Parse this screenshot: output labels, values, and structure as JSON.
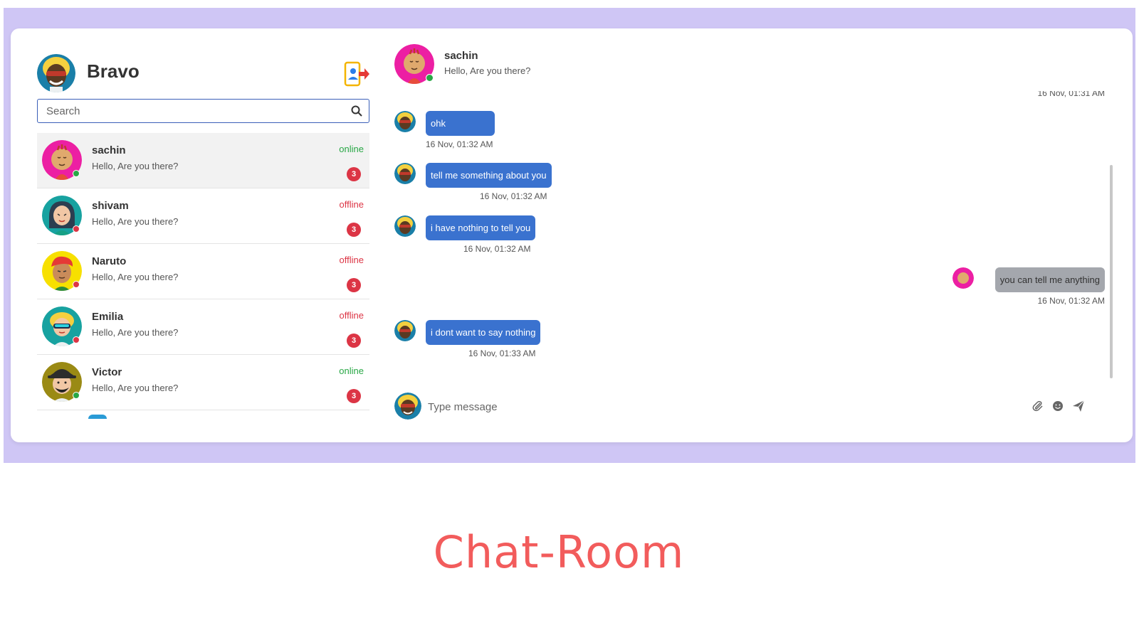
{
  "colors": {
    "background_frame": "#cfc6f5",
    "outgoing_bubble": "#3a72cf",
    "incoming_bubble": "#a4a7ad",
    "online": "#28a745",
    "offline": "#dc3545",
    "caption": "#f25c5c"
  },
  "user": {
    "name": "Bravo"
  },
  "search": {
    "placeholder": "Search"
  },
  "contacts": [
    {
      "name": "sachin",
      "preview": "Hello, Are you there?",
      "status": "online",
      "unread": "3"
    },
    {
      "name": "shivam",
      "preview": "Hello, Are you there?",
      "status": "offline",
      "unread": "3"
    },
    {
      "name": "Naruto",
      "preview": "Hello, Are you there?",
      "status": "offline",
      "unread": "3"
    },
    {
      "name": "Emilia",
      "preview": "Hello, Are you there?",
      "status": "offline",
      "unread": "3"
    },
    {
      "name": "Victor",
      "preview": "Hello, Are you there?",
      "status": "online",
      "unread": "3"
    }
  ],
  "chat": {
    "name": "sachin",
    "subtitle": "Hello, Are you there?",
    "partial_time": "16 Nov, 01:31 AM",
    "messages": [
      {
        "direction": "out",
        "text": "ohk",
        "time": "16 Nov, 01:32 AM"
      },
      {
        "direction": "out",
        "text": "tell me something about you",
        "time": "16 Nov, 01:32 AM"
      },
      {
        "direction": "out",
        "text": "i have nothing to tell you",
        "time": "16 Nov, 01:32 AM"
      },
      {
        "direction": "in",
        "text": "you can tell me anything",
        "time": "16 Nov, 01:32 AM"
      },
      {
        "direction": "out",
        "text": "i dont want to say nothing",
        "time": "16 Nov, 01:33 AM"
      }
    ],
    "composer_placeholder": "Type message"
  },
  "icons": {
    "logout": "logout-icon",
    "search": "search-icon",
    "attach": "paperclip-icon",
    "emoji": "emoji-icon",
    "send": "send-icon"
  },
  "caption": "Chat-Room"
}
